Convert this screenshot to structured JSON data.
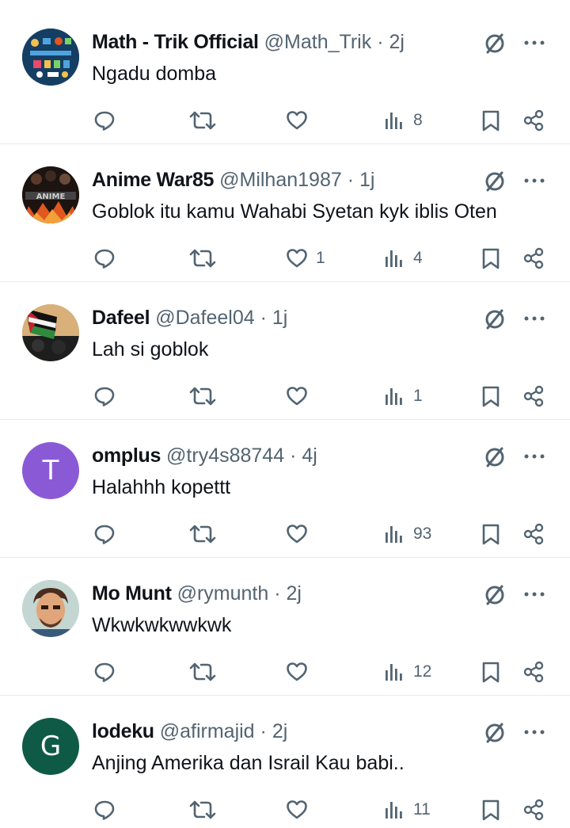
{
  "posts": [
    {
      "name": "Math - Trik Official",
      "handle": "@Math_Trik",
      "dot": "·",
      "time": "2j",
      "text": "Ngadu domba",
      "likes": "",
      "views": "8",
      "avatar": {
        "type": "image",
        "bg": "#1b4a73",
        "accent": "#4fa3e0",
        "label": "MATHEMATICS"
      }
    },
    {
      "name": "Anime War85",
      "handle": "@Milhan1987",
      "dot": "·",
      "time": "1j",
      "text": "Goblok itu kamu Wahabi Syetan kyk iblis Oten",
      "likes": "1",
      "views": "4",
      "avatar": {
        "type": "image",
        "bg": "#2a1a12",
        "accent": "#e0581f",
        "label": "ANIME"
      }
    },
    {
      "name": "Dafeel",
      "handle": "@Dafeel04",
      "dot": "·",
      "time": "1j",
      "text": "Lah si goblok",
      "likes": "",
      "views": "1",
      "avatar": {
        "type": "image",
        "bg": "#caa06a",
        "accent": "#2b2b2b"
      }
    },
    {
      "name": "omplus",
      "handle": "@try4s88744",
      "dot": "·",
      "time": "4j",
      "text": "Halahhh kopettt",
      "likes": "",
      "views": "93",
      "avatar": {
        "type": "letter",
        "letter": "T",
        "bg": "#8a5ad6"
      }
    },
    {
      "name": "Mo Munt",
      "handle": "@rymunth",
      "dot": "·",
      "time": "2j",
      "text": "Wkwkwkwwkwk",
      "likes": "",
      "views": "12",
      "avatar": {
        "type": "image",
        "bg": "#bfd3d0",
        "accent": "#7a4a2e"
      }
    },
    {
      "name": "lodeku",
      "handle": "@afirmajid",
      "dot": "·",
      "time": "2j",
      "text": "Anjing Amerika dan Israil Kau babi..",
      "likes": "",
      "views": "11",
      "avatar": {
        "type": "letter",
        "letter": "G",
        "bg": "#0f5a46"
      }
    }
  ],
  "icons": {
    "reply": "reply-icon",
    "repost": "repost-icon",
    "like": "like-icon",
    "views": "views-icon",
    "bookmark": "bookmark-icon",
    "share": "share-icon",
    "grok": "grok-icon",
    "more": "more-icon"
  },
  "colors": {
    "icon": "#536471",
    "text": "#0f1419",
    "divider": "#e8eaec"
  }
}
